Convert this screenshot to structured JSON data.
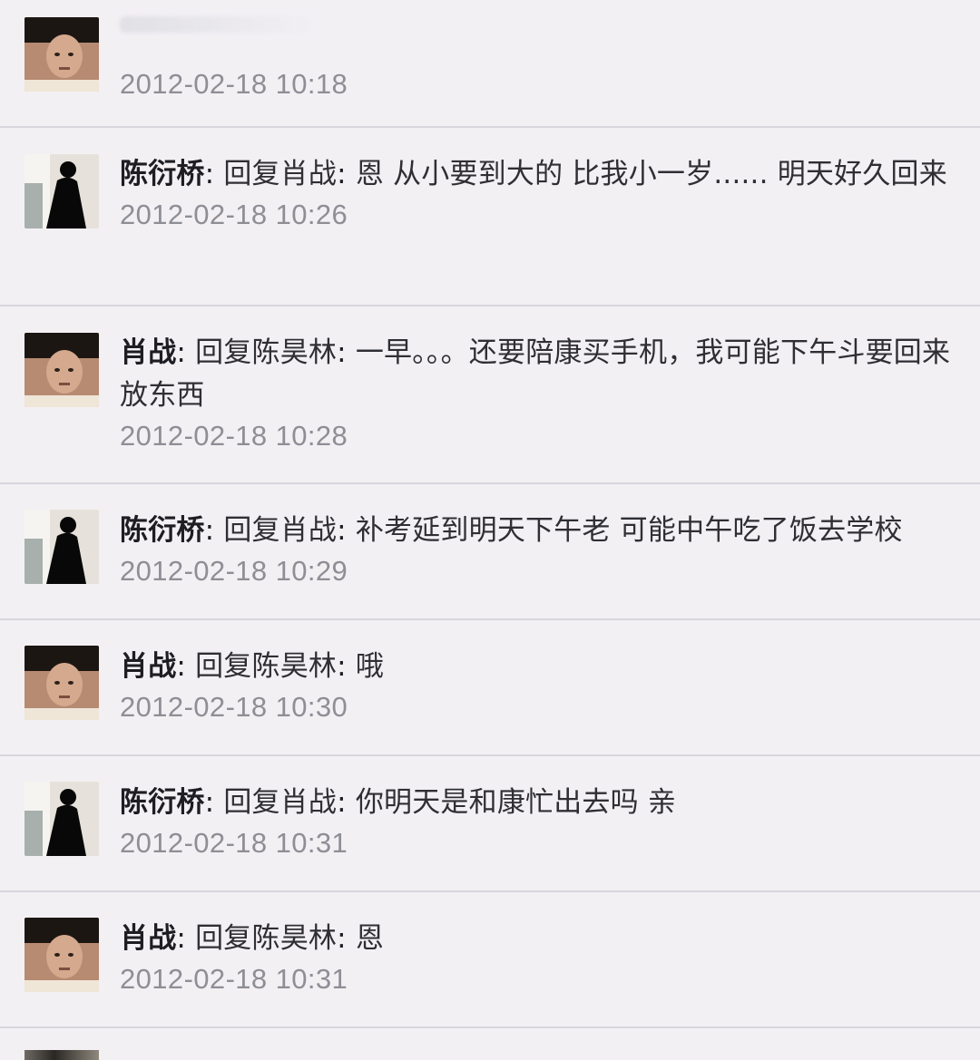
{
  "comments": [
    {
      "author": "",
      "reply_to_label": "",
      "text": "",
      "time": "2012-02-18 10:18"
    },
    {
      "author": "陈衍桥",
      "reply_to_label": "回复肖战",
      "text": "恩 从小要到大的 比我小一岁...... 明天好久回来",
      "time": "2012-02-18 10:26"
    },
    {
      "author": "肖战",
      "reply_to_label": "回复陈昊林",
      "text": "一早。。。还要陪康买手机，我可能下午斗要回来放东西",
      "time": "2012-02-18 10:28"
    },
    {
      "author": "陈衍桥",
      "reply_to_label": "回复肖战",
      "text": "补考延到明天下午老 可能中午吃了饭去学校",
      "time": "2012-02-18 10:29"
    },
    {
      "author": "肖战",
      "reply_to_label": "回复陈昊林",
      "text": "哦",
      "time": "2012-02-18 10:30"
    },
    {
      "author": "陈衍桥",
      "reply_to_label": "回复肖战",
      "text": "你明天是和康忙出去吗 亲",
      "time": "2012-02-18 10:31"
    },
    {
      "author": "肖战",
      "reply_to_label": "回复陈昊林",
      "text": "恩",
      "time": "2012-02-18 10:31"
    }
  ],
  "icons": {
    "avatar_portrait": "portrait-avatar-icon",
    "avatar_silhouette": "silhouette-avatar-icon"
  },
  "colors": {
    "background": "#f3f0f4",
    "divider": "#d8d6dc",
    "text": "#2f2f33",
    "timestamp": "#8e8e95"
  }
}
